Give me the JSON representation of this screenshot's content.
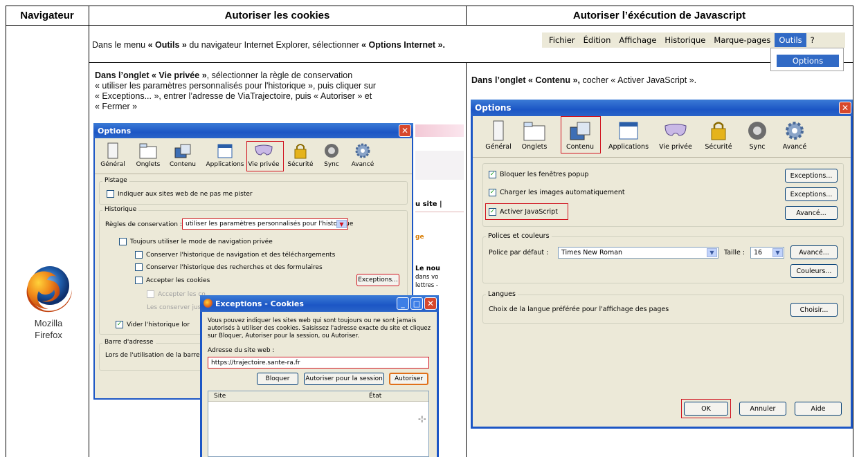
{
  "table": {
    "headers": [
      "Navigateur",
      "Autoriser les cookies",
      "Autoriser l’éxécution de Javascript"
    ]
  },
  "browser": {
    "name_line1": "Mozilla",
    "name_line2": "Firefox"
  },
  "instruction_menu": {
    "prefix": "Dans le menu ",
    "menu": "« Outils »",
    "middle": " du navigateur Internet Explorer, sélectionner ",
    "option": "« Options Internet ».",
    "end": ""
  },
  "instruction_cookies": {
    "tab": "Dans l’onglet « Vie privée »",
    "line1": ", sélectionner la règle de conservation",
    "line2": "« utiliser les paramètres personnalisés pour l'historique », puis cliquer sur",
    "line3": "« Exceptions... », entrer l’adresse de ViaTrajectoire, puis « Autoriser » et",
    "line4": "« Fermer »"
  },
  "instruction_js": {
    "tab": "Dans l’onglet « Contenu »,",
    "rest": " cocher « Activer JavaScript »."
  },
  "menubar": {
    "items": [
      "Fichier",
      "Édition",
      "Affichage",
      "Historique",
      "Marque-pages",
      "Outils",
      "?"
    ],
    "active": "Outils",
    "dropdown_item": "Options"
  },
  "options_small": {
    "title": "Options",
    "tabs": [
      "Général",
      "Onglets",
      "Contenu",
      "Applications",
      "Vie privée",
      "Sécurité",
      "Sync",
      "Avancé"
    ],
    "pistage_label": "Pistage",
    "pistage_check": "Indiquer aux sites web de ne pas me pister",
    "historique_label": "Historique",
    "regles_label": "Règles de conservation :",
    "regles_value": "utiliser les paramètres personnalisés pour l'historique",
    "opt_private": "Toujours utiliser le mode de navigation privée",
    "opt_nav": "Conserver l'historique de navigation et des téléchargements",
    "opt_search": "Conserver l'historique des recherches et des formulaires",
    "opt_cookies": "Accepter les cookies",
    "exceptions_button": "Exceptions...",
    "opt_third": "Accepter les co",
    "keep": "Les conserver jusq",
    "clear": "Vider l'historique lor",
    "address_label": "Barre d'adresse",
    "address_text": "Lors de l'utilisation de la barre d'a"
  },
  "bg_page": {
    "text1": "u site  |",
    "text2": "ge",
    "text3": "Le nou",
    "text4": "dans vo",
    "text5": "lettres -"
  },
  "exceptions_dialog": {
    "title": "Exceptions - Cookies",
    "desc1": "Vous pouvez indiquer les sites web qui sont toujours ou ne sont jamais",
    "desc2": "autorisés à utiliser des cookies. Saisissez l'adresse exacte du site et cliquez",
    "desc3": "sur Bloquer, Autoriser pour la session, ou Autoriser.",
    "address_label": "Adresse du site web :",
    "address_value": "https://trajectoire.sante-ra.fr",
    "btn_block": "Bloquer",
    "btn_session": "Autoriser pour la session",
    "btn_allow": "Autoriser",
    "col_site": "Site",
    "col_state": "État"
  },
  "options_large": {
    "title": "Options",
    "tabs": [
      "Général",
      "Onglets",
      "Contenu",
      "Applications",
      "Vie privée",
      "Sécurité",
      "Sync",
      "Avancé"
    ],
    "popup": "Bloquer les fenêtres popup",
    "images": "Charger les images automatiquement",
    "js": "Activer JavaScript",
    "btn_exc1": "Exceptions...",
    "btn_exc2": "Exceptions...",
    "btn_adv1": "Avancé...",
    "fonts_label": "Polices et couleurs",
    "font_default_label": "Police par défaut :",
    "font_default_value": "Times New Roman",
    "size_label": "Taille :",
    "size_value": "16",
    "btn_adv2": "Avancé...",
    "btn_colors": "Couleurs...",
    "lang_label": "Langues",
    "lang_text": "Choix de la langue préférée pour l'affichage des pages",
    "btn_choose": "Choisir...",
    "btn_ok": "OK",
    "btn_cancel": "Annuler",
    "btn_help": "Aide"
  }
}
